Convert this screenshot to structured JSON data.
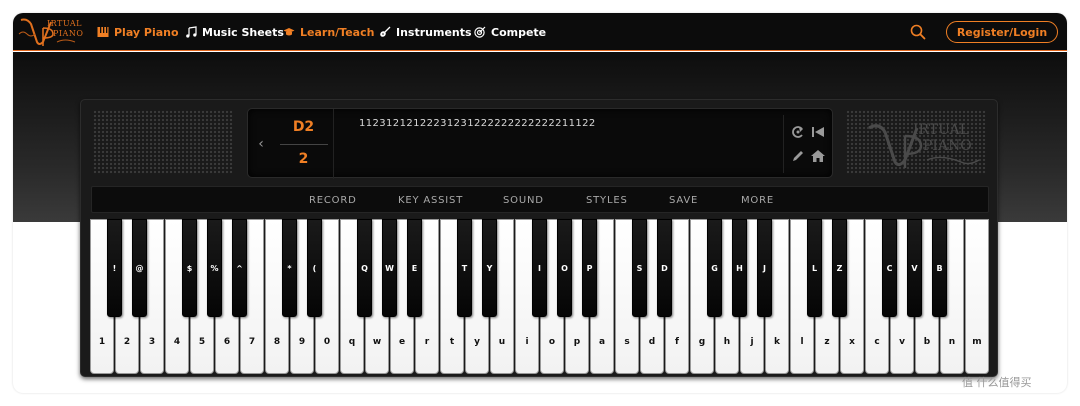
{
  "nav": {
    "logo_text_top": "IRTUAL",
    "logo_text_bottom": "PIANO",
    "items": [
      {
        "label": "Play Piano",
        "icon": "piano-icon"
      },
      {
        "label": "Music Sheets",
        "icon": "music-notes-icon"
      },
      {
        "label": "Learn/Teach",
        "icon": "graduation-cap-icon"
      },
      {
        "label": "Instruments",
        "icon": "guitar-icon"
      },
      {
        "label": "Compete",
        "icon": "target-icon"
      }
    ],
    "register_label": "Register/Login"
  },
  "colors": {
    "accent": "#f07f24",
    "nav_bg": "#0c0c0c",
    "piano_bg": "#1a1a1a"
  },
  "display": {
    "note_top": "D2",
    "note_bottom": "2",
    "sheet": "11231212122231231222222222222211122"
  },
  "menu": [
    "RECORD",
    "KEY ASSIST",
    "SOUND",
    "STYLES",
    "SAVE",
    "MORE"
  ],
  "white_keys": [
    "1",
    "2",
    "3",
    "4",
    "5",
    "6",
    "7",
    "8",
    "9",
    "0",
    "q",
    "w",
    "e",
    "r",
    "t",
    "y",
    "u",
    "i",
    "o",
    "p",
    "a",
    "s",
    "d",
    "f",
    "g",
    "h",
    "j",
    "k",
    "l",
    "z",
    "x",
    "c",
    "v",
    "b",
    "n",
    "m"
  ],
  "black_keys": [
    "!",
    "@",
    "$",
    "%",
    "^",
    "*",
    "(",
    "Q",
    "W",
    "E",
    "T",
    "Y",
    "I",
    "O",
    "P",
    "S",
    "D",
    "G",
    "H",
    "J",
    "L",
    "Z",
    "C",
    "V",
    "B"
  ],
  "watermark": "值 什么值得买"
}
